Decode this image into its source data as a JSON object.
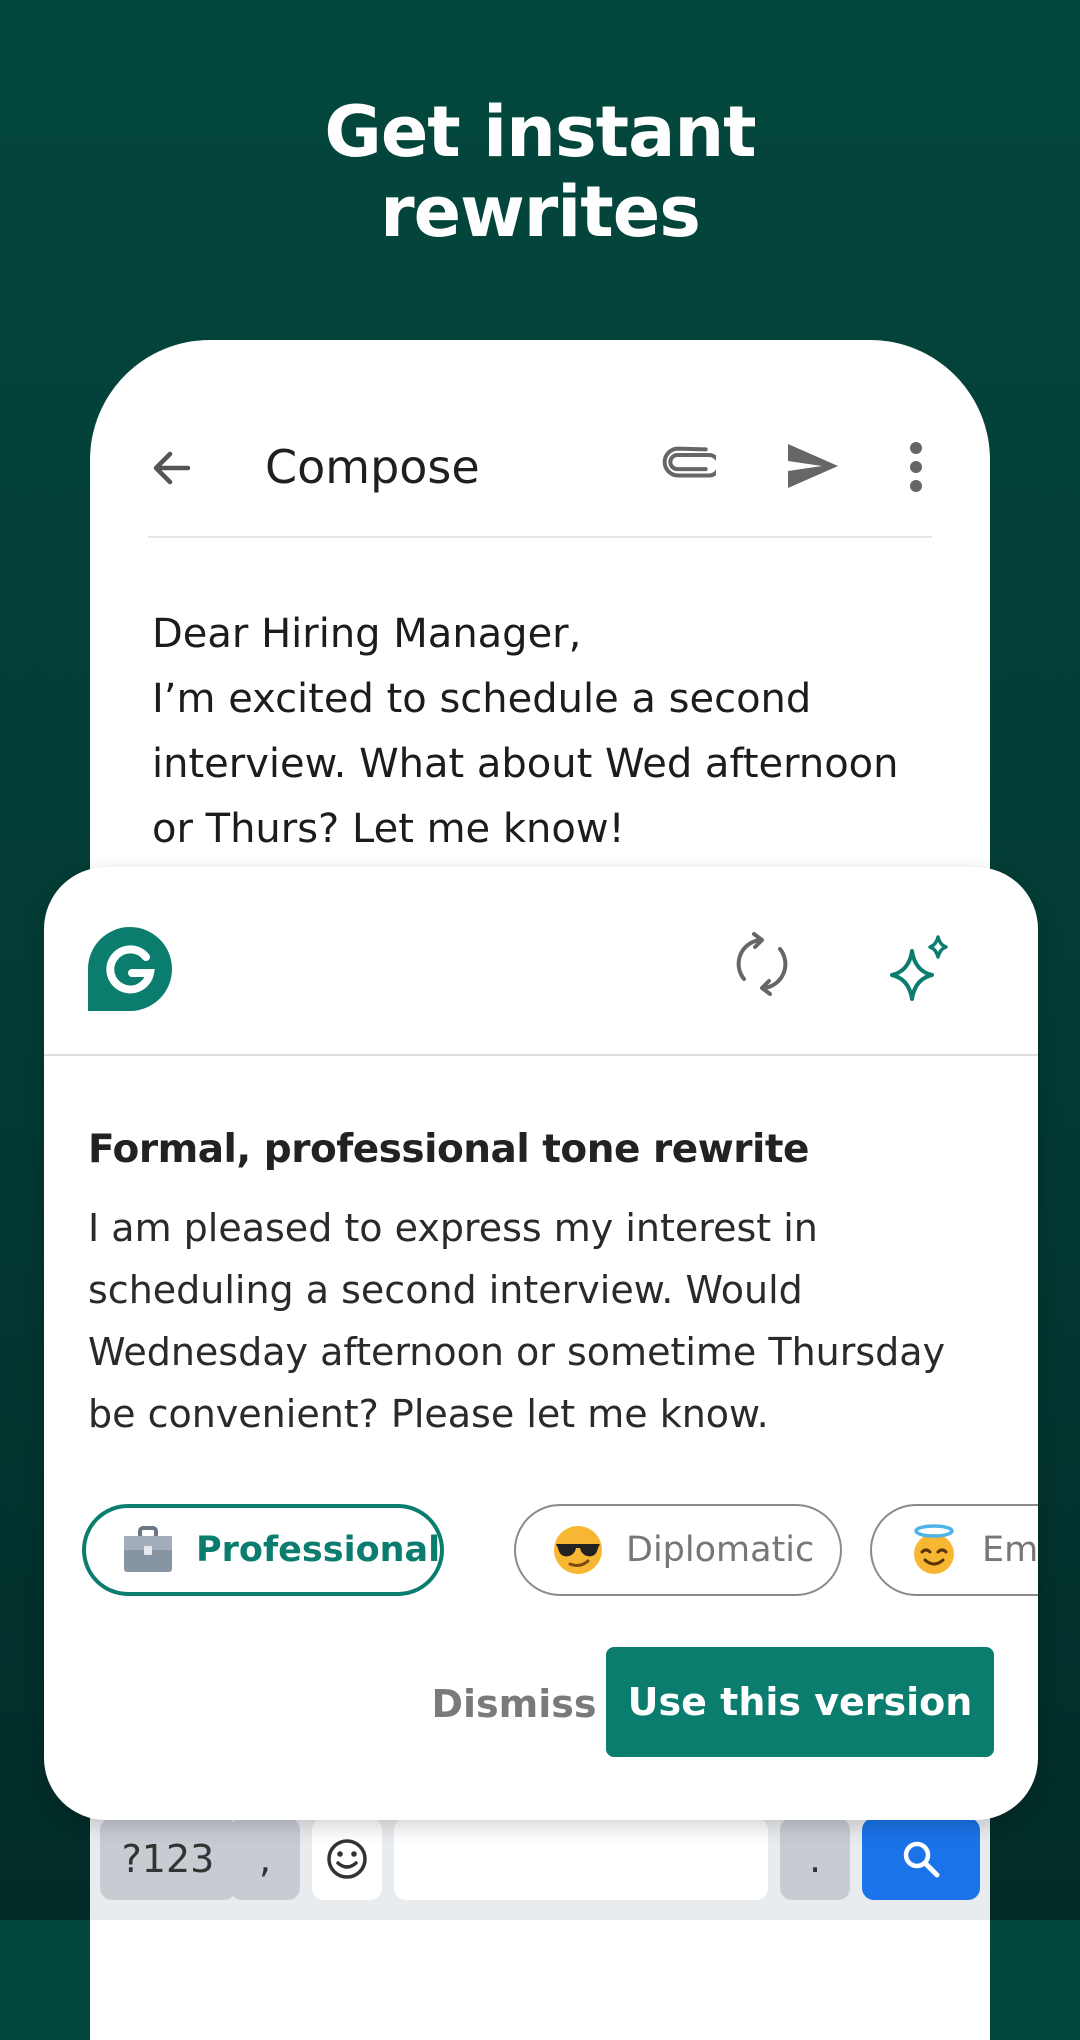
{
  "headline": {
    "line1": "Get instant",
    "line2": "rewrites"
  },
  "compose": {
    "title": "Compose",
    "icons": [
      "back-arrow-icon",
      "paperclip-icon",
      "send-icon",
      "more-vert-icon"
    ],
    "body_lines": [
      "Dear Hiring Manager,",
      "I’m excited to schedule a second",
      "interview. What about Wed afternoon",
      "or Thurs? Let me know!"
    ]
  },
  "card": {
    "icons": [
      "grammarly-logo-icon",
      "refresh-icon",
      "sparkle-icon"
    ],
    "title": "Formal, professional tone rewrite",
    "body_lines": [
      "I am pleased to express my interest in",
      "scheduling a second interview. Would",
      "Wednesday afternoon or sometime Thursday",
      "be convenient? Please let me know."
    ],
    "chips": [
      {
        "label": "Professional",
        "icon": "briefcase-icon",
        "selected": true
      },
      {
        "label": "Diplomatic",
        "icon": "sunglasses-face-icon",
        "selected": false
      },
      {
        "label": "Empathetic",
        "icon": "halo-face-icon",
        "selected": false
      }
    ],
    "dismiss_label": "Dismiss",
    "use_label": "Use this version"
  },
  "keyboard": {
    "symbols_key": "?123",
    "comma_key": ",",
    "period_key": ".",
    "icons": [
      "emoji-icon",
      "search-icon"
    ]
  },
  "colors": {
    "background": "#03473d",
    "accent": "#0b7d6e",
    "search_key": "#1a73e8"
  }
}
